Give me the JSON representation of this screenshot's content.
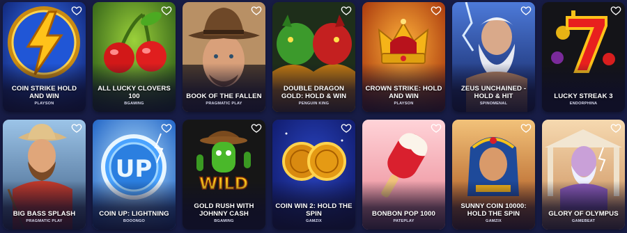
{
  "games": [
    {
      "title": "COIN STRIKE HOLD AND WIN",
      "provider": "PLAYSON",
      "icon": "lightning-coin-icon",
      "bg": "#1c3fb0"
    },
    {
      "title": "ALL LUCKY CLOVERS 100",
      "provider": "BGAMING",
      "icon": "cherries-icon",
      "bg": "#3f7a1c"
    },
    {
      "title": "BOOK OF THE FALLEN",
      "provider": "PRAGMATIC PLAY",
      "icon": "cowboy-icon",
      "bg": "#8a6a45"
    },
    {
      "title": "DOUBLE DRAGON GOLD: HOLD & WIN",
      "provider": "PENGUIN KING",
      "icon": "dragons-icon",
      "bg": "#2b4a22"
    },
    {
      "title": "CROWN STRIKE: HOLD AND WIN",
      "provider": "PLAYSON",
      "icon": "crown-icon",
      "bg": "#c0470f"
    },
    {
      "title": "ZEUS UNCHAINED - HOLD & HIT",
      "provider": "SPINOMENAL",
      "icon": "zeus-icon",
      "bg": "#1c3a86"
    },
    {
      "title": "LUCKY STREAK 3",
      "provider": "ENDORPHINA",
      "icon": "lucky-seven-icon",
      "bg": "#1a1a1e"
    },
    {
      "title": "BIG BASS SPLASH",
      "provider": "PRAGMATIC PLAY",
      "icon": "fisherman-icon",
      "bg": "#5f7fa8"
    },
    {
      "title": "COIN UP: LIGHTNING",
      "provider": "BOOONGO",
      "icon": "up-coin-icon",
      "bg": "#2a7fd9"
    },
    {
      "title": "GOLD RUSH WITH JOHNNY CASH",
      "provider": "BGAMING",
      "icon": "cactus-wild-icon",
      "bg": "#1a1a1a"
    },
    {
      "title": "COIN WIN 2: HOLD THE SPIN",
      "provider": "GAMZIX",
      "icon": "gold-coins-icon",
      "bg": "#15257a"
    },
    {
      "title": "BONBON POP 1000",
      "provider": "PATEPLAY",
      "icon": "popsicle-icon",
      "bg": "#f2a9b3"
    },
    {
      "title": "SUNNY COIN 10000: HOLD THE SPIN",
      "provider": "GAMZIX",
      "icon": "pharaoh-queen-icon",
      "bg": "#d9893a"
    },
    {
      "title": "GLORY OF OLYMPUS",
      "provider": "GAMEBEAT",
      "icon": "olympus-god-icon",
      "bg": "#e3b787"
    }
  ],
  "favorite_icon": "heart-outline-icon",
  "colors": {
    "page_background": "#171c45",
    "card_text": "#ffffff"
  }
}
